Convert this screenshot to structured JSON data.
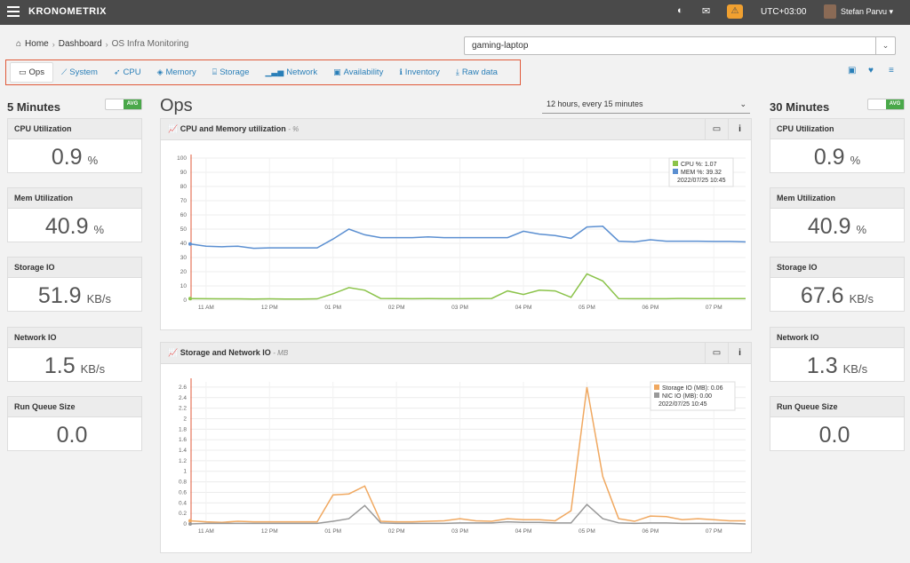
{
  "app": {
    "brand": "KRONOMETRIX",
    "timezone": "UTC+03:00",
    "username": "Stefan Parvu ▾",
    "alert_count": "⚠"
  },
  "breadcrumb": {
    "home": "Home",
    "dashboard": "Dashboard",
    "current": "OS Infra Monitoring"
  },
  "host_select": {
    "value": "gaming-laptop"
  },
  "tabs": [
    {
      "label": "Ops",
      "icon": "monitor-icon"
    },
    {
      "label": "System",
      "icon": "area-chart-icon"
    },
    {
      "label": "CPU",
      "icon": "rocket-icon"
    },
    {
      "label": "Memory",
      "icon": "cube-icon"
    },
    {
      "label": "Storage",
      "icon": "hdd-icon"
    },
    {
      "label": "Network",
      "icon": "bar-chart-icon"
    },
    {
      "label": "Availability",
      "icon": "calendar-check-icon"
    },
    {
      "label": "Inventory",
      "icon": "info-icon"
    },
    {
      "label": "Raw data",
      "icon": "download-icon"
    }
  ],
  "left": {
    "title": "5 Minutes",
    "toggle": "AVG",
    "metrics": [
      {
        "label": "CPU Utilization",
        "value": "0.9",
        "unit": "%"
      },
      {
        "label": "Mem Utilization",
        "value": "40.9",
        "unit": "%"
      },
      {
        "label": "Storage IO",
        "value": "51.9",
        "unit": "KB/s"
      },
      {
        "label": "Network IO",
        "value": "1.5",
        "unit": "KB/s"
      },
      {
        "label": "Run Queue Size",
        "value": "0.0",
        "unit": ""
      }
    ]
  },
  "right": {
    "title": "30 Minutes",
    "toggle": "AVG",
    "metrics": [
      {
        "label": "CPU Utilization",
        "value": "0.9",
        "unit": "%"
      },
      {
        "label": "Mem Utilization",
        "value": "40.9",
        "unit": "%"
      },
      {
        "label": "Storage IO",
        "value": "67.6",
        "unit": "KB/s"
      },
      {
        "label": "Network IO",
        "value": "1.3",
        "unit": "KB/s"
      },
      {
        "label": "Run Queue Size",
        "value": "0.0",
        "unit": ""
      }
    ]
  },
  "center": {
    "title": "Ops",
    "range": "12 hours, every 15 minutes"
  },
  "colors": {
    "accent": "#2a7fb8",
    "cpu": "#8bc34a",
    "mem": "#5b8fd1",
    "storage": "#f0a860",
    "nic": "#999999",
    "tabs_border": "#e05a3a",
    "marker": "#e05a3a"
  },
  "chart_data": [
    {
      "type": "line",
      "title": "CPU and Memory utilization",
      "unit": "%",
      "x_ticks": [
        "11 AM",
        "12 PM",
        "01 PM",
        "02 PM",
        "03 PM",
        "04 PM",
        "05 PM",
        "06 PM",
        "07 PM"
      ],
      "y_ticks": [
        0,
        10,
        20,
        30,
        40,
        50,
        60,
        70,
        80,
        90,
        100
      ],
      "ylim": [
        0,
        100
      ],
      "x_hours": [
        10.75,
        11,
        11.25,
        11.5,
        11.75,
        12,
        12.25,
        12.5,
        12.75,
        13,
        13.25,
        13.5,
        13.75,
        14,
        14.25,
        14.5,
        14.75,
        15,
        15.25,
        15.5,
        15.75,
        16,
        16.25,
        16.5,
        16.75,
        17,
        17.25,
        17.5,
        17.75,
        18,
        18.25,
        18.5,
        18.75,
        19,
        19.25,
        19.5
      ],
      "series": [
        {
          "name": "CPU %",
          "color": "#8bc34a",
          "values": [
            1.1,
            1.0,
            0.9,
            0.9,
            0.8,
            0.9,
            0.8,
            0.8,
            0.9,
            4.5,
            8.8,
            7.0,
            1.2,
            1.1,
            1.0,
            1.1,
            1.0,
            1.0,
            1.1,
            1.2,
            6.5,
            4.0,
            7.0,
            6.5,
            2.0,
            18.5,
            13.5,
            1.1,
            1.0,
            1.0,
            1.0,
            1.2,
            1.1,
            1.1,
            1.1,
            1.07
          ]
        },
        {
          "name": "MEM %",
          "color": "#5b8fd1",
          "values": [
            39.5,
            38.0,
            37.6,
            38.0,
            36.5,
            36.8,
            36.8,
            36.8,
            36.8,
            43.0,
            50.0,
            46.0,
            44.0,
            44.0,
            44.0,
            44.5,
            44.0,
            44.0,
            44.0,
            44.0,
            44.0,
            48.5,
            46.5,
            45.5,
            43.5,
            51.5,
            52.0,
            41.5,
            41.0,
            42.5,
            41.5,
            41.5,
            41.5,
            41.3,
            41.3,
            41.0
          ]
        }
      ],
      "tooltip": {
        "cpu": "CPU %: 1.07",
        "mem": "MEM %: 39.32",
        "time": "2022/07/25 10:45"
      }
    },
    {
      "type": "line",
      "title": "Storage and Network IO",
      "unit": "MB",
      "x_ticks": [
        "11 AM",
        "12 PM",
        "01 PM",
        "02 PM",
        "03 PM",
        "04 PM",
        "05 PM",
        "06 PM",
        "07 PM"
      ],
      "y_ticks": [
        0,
        0.2,
        0.4,
        0.6,
        0.8,
        1,
        1.2,
        1.4,
        1.6,
        1.8,
        2,
        2.2,
        2.4,
        2.6
      ],
      "ylim": [
        0,
        2.7
      ],
      "x_hours": [
        10.75,
        11,
        11.25,
        11.5,
        11.75,
        12,
        12.25,
        12.5,
        12.75,
        13,
        13.25,
        13.5,
        13.75,
        14,
        14.25,
        14.5,
        14.75,
        15,
        15.25,
        15.5,
        15.75,
        16,
        16.25,
        16.5,
        16.75,
        17,
        17.25,
        17.5,
        17.75,
        18,
        18.25,
        18.5,
        18.75,
        19,
        19.25,
        19.5
      ],
      "series": [
        {
          "name": "Storage IO (MB)",
          "color": "#f0a860",
          "values": [
            0.06,
            0.04,
            0.03,
            0.05,
            0.04,
            0.04,
            0.04,
            0.04,
            0.04,
            0.55,
            0.57,
            0.72,
            0.05,
            0.04,
            0.04,
            0.05,
            0.06,
            0.1,
            0.06,
            0.05,
            0.1,
            0.08,
            0.08,
            0.06,
            0.25,
            2.6,
            0.9,
            0.1,
            0.05,
            0.15,
            0.14,
            0.08,
            0.1,
            0.08,
            0.06,
            0.06
          ]
        },
        {
          "name": "NIC IO (MB)",
          "color": "#999999",
          "values": [
            0.0,
            0.01,
            0.01,
            0.01,
            0.01,
            0.01,
            0.01,
            0.01,
            0.01,
            0.05,
            0.1,
            0.35,
            0.02,
            0.01,
            0.01,
            0.01,
            0.01,
            0.02,
            0.02,
            0.02,
            0.04,
            0.03,
            0.03,
            0.02,
            0.02,
            0.37,
            0.1,
            0.02,
            0.01,
            0.02,
            0.02,
            0.01,
            0.01,
            0.01,
            0.01,
            0.0
          ]
        }
      ],
      "tooltip": {
        "storage": "Storage IO (MB): 0.06",
        "nic": "NIC IO (MB): 0.00",
        "time": "2022/07/25 10:45"
      }
    }
  ]
}
